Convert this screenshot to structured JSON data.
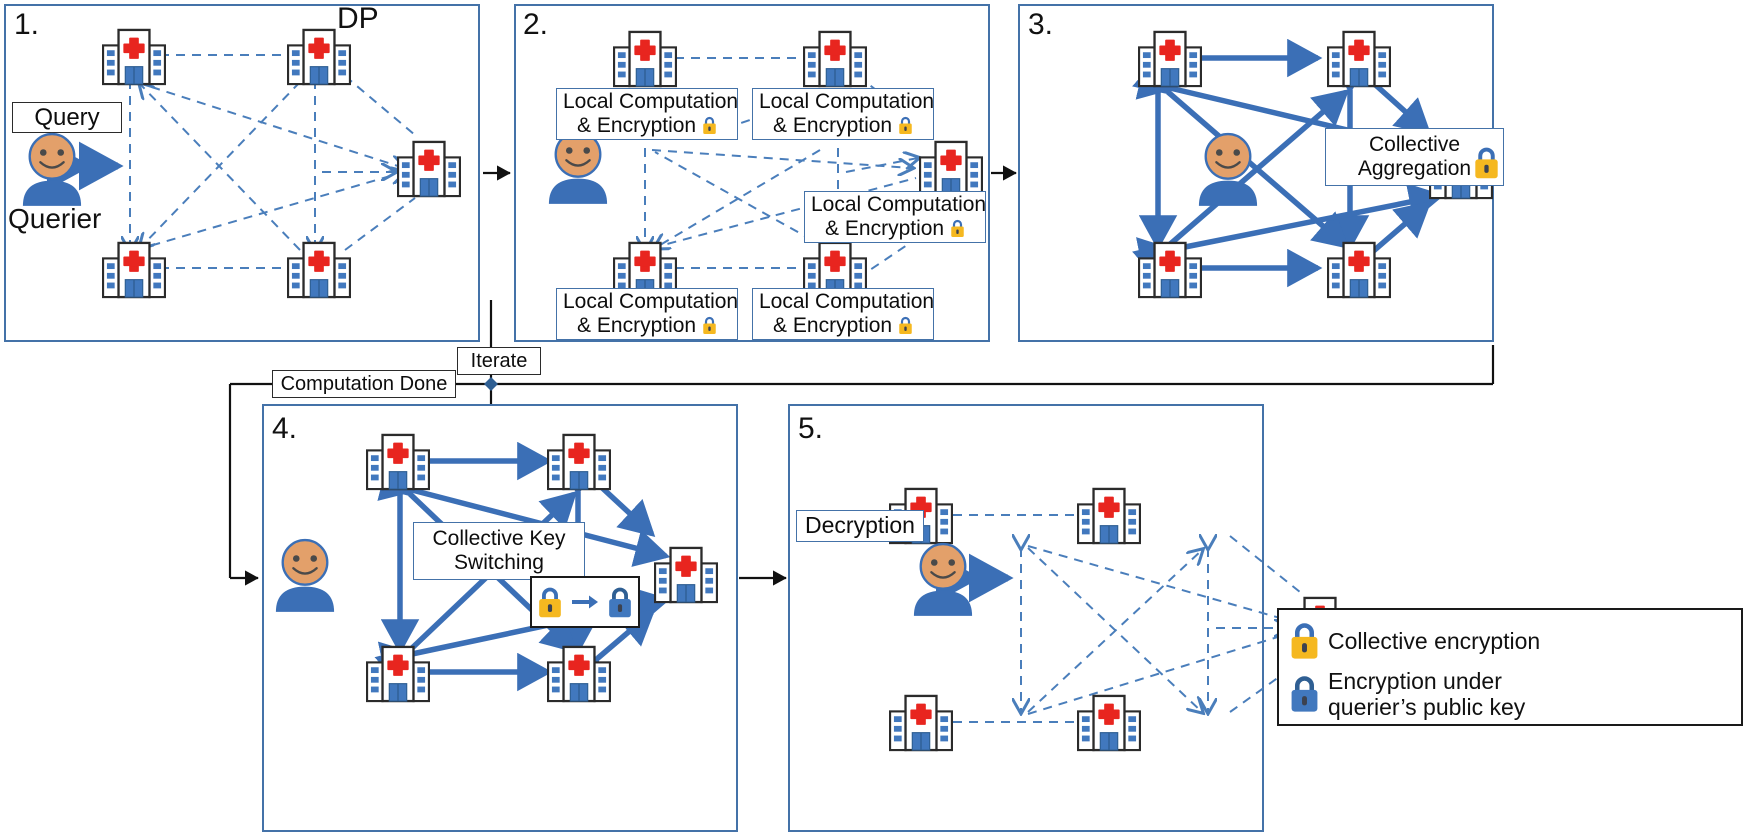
{
  "figure": {
    "title_hint": "Federated privacy-preserving query workflow",
    "accent_blue": "#4472a8",
    "arrow_blue": "#3b6fb6",
    "dash_blue": "#4a7ebb",
    "lock_collective_color": "#f5b820",
    "lock_querier_color": "#3b6fb6",
    "cross_red": "#e8251f",
    "person_skin": "#e3a06a",
    "person_body": "#3b6fb6"
  },
  "panels": [
    {
      "id": "p1",
      "number": "1.",
      "dp_label": "DP",
      "query_label": "Query",
      "querier_label": "Querier",
      "link_style": "dashed"
    },
    {
      "id": "p2",
      "number": "2.",
      "boxes": [
        {
          "line1": "Local Computation",
          "line2": "& Encryption",
          "lock": "collective-lock-icon"
        },
        {
          "line1": "Local Computation",
          "line2": "& Encryption",
          "lock": "collective-lock-icon"
        },
        {
          "line1": "Local Computation",
          "line2": "& Encryption",
          "lock": "collective-lock-icon"
        },
        {
          "line1": "Local Computation",
          "line2": "& Encryption",
          "lock": "collective-lock-icon"
        },
        {
          "line1": "Local Computation",
          "line2": "& Encryption",
          "lock": "collective-lock-icon"
        }
      ],
      "link_style": "dashed"
    },
    {
      "id": "p3",
      "number": "3.",
      "box": {
        "line1": "Collective",
        "line2": "Aggregation",
        "lock": "collective-lock-icon"
      },
      "link_style": "solid-double-arrow"
    },
    {
      "id": "p4",
      "number": "4.",
      "box": {
        "line1": "Collective Key",
        "line2": "Switching"
      },
      "keyswitch": {
        "from_lock": "collective-lock-icon",
        "to_lock": "querier-lock-icon",
        "arrow": "right-arrow-icon"
      },
      "link_style": "solid-double-arrow"
    },
    {
      "id": "p5",
      "number": "5.",
      "decryption_label": "Decryption",
      "link_style": "dashed"
    }
  ],
  "flow": {
    "iterate_label": "Iterate",
    "computation_done_label": "Computation Done"
  },
  "legend": {
    "items": [
      {
        "icon": "collective-lock-icon",
        "text": "Collective encryption",
        "color": "#f5b820"
      },
      {
        "icon": "querier-lock-icon",
        "text_line1": "Encryption under",
        "text_line2": "querier’s public key",
        "color": "#3b6fb6"
      }
    ]
  }
}
